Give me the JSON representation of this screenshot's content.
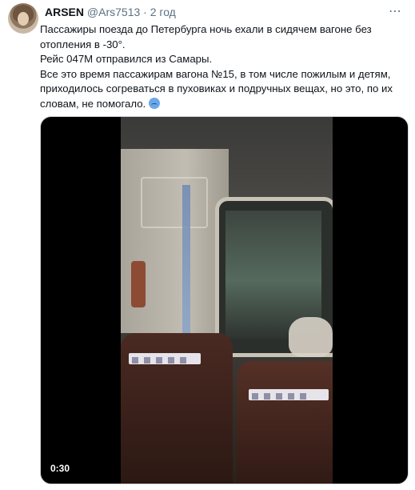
{
  "tweet": {
    "author_name": "ARSEN",
    "handle": "@Ars7513",
    "separator": "·",
    "time": "2 год",
    "more_icon": "more-dots-icon",
    "lines": [
      "Пассажиры поезда до Петербурга ночь ехали в сидячем вагоне без отопления в -30°.",
      "Рейс 047М отправился из Самары.",
      "Все это время пассажирам вагона №15, в том числе пожилым и детям, приходилось согреваться в пуховиках и подручных вещах, но это, по их словам, не помогало."
    ],
    "emoji": "cold-face-emoji"
  },
  "video": {
    "duration": "0:30"
  }
}
